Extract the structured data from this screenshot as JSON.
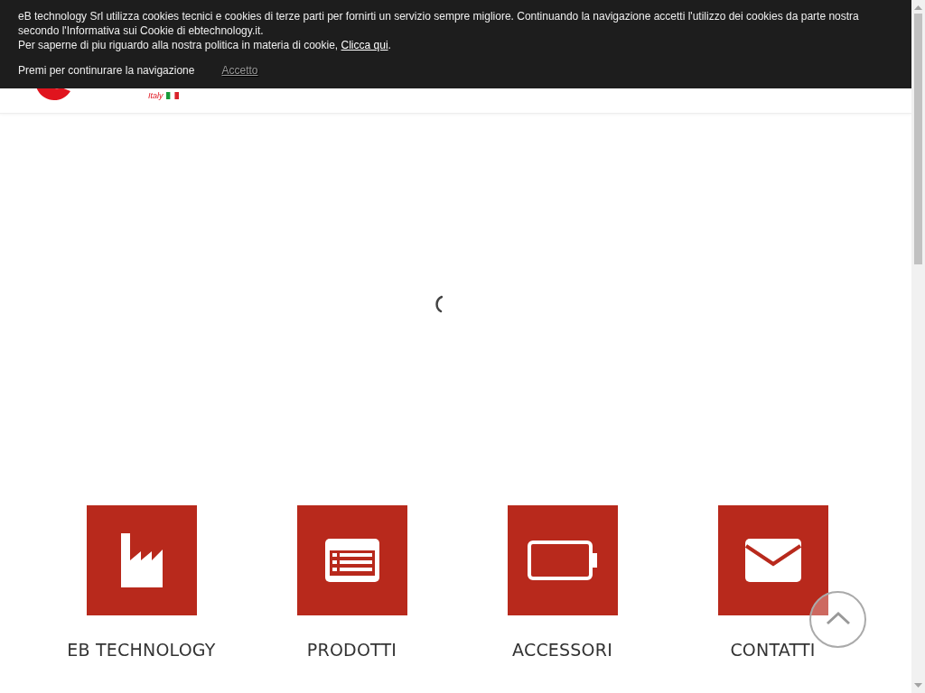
{
  "cookie_bar": {
    "message": "eB technology Srl utilizza cookies tecnici e cookies di terze parti per fornirti un servizio sempre migliore. Continuando la navigazione accetti l'utilizzo dei cookies da parte nostra secondo l'Informativa sui Cookie di ebtechnology.it.",
    "policy_text": "Per saperne di piu riguardo alla nostra politica in materia di cookie,",
    "policy_link": "Clicca qui",
    "policy_end": ".",
    "continue_text": "Premi per continurare la navigazione",
    "accept_button": "Accetto"
  },
  "logo": {
    "tagline": "Italy"
  },
  "features": [
    {
      "label": "EB TECHNOLOGY"
    },
    {
      "label": "PRODOTTI"
    },
    {
      "label": "ACCESSORI"
    },
    {
      "label": "CONTATTI"
    }
  ]
}
